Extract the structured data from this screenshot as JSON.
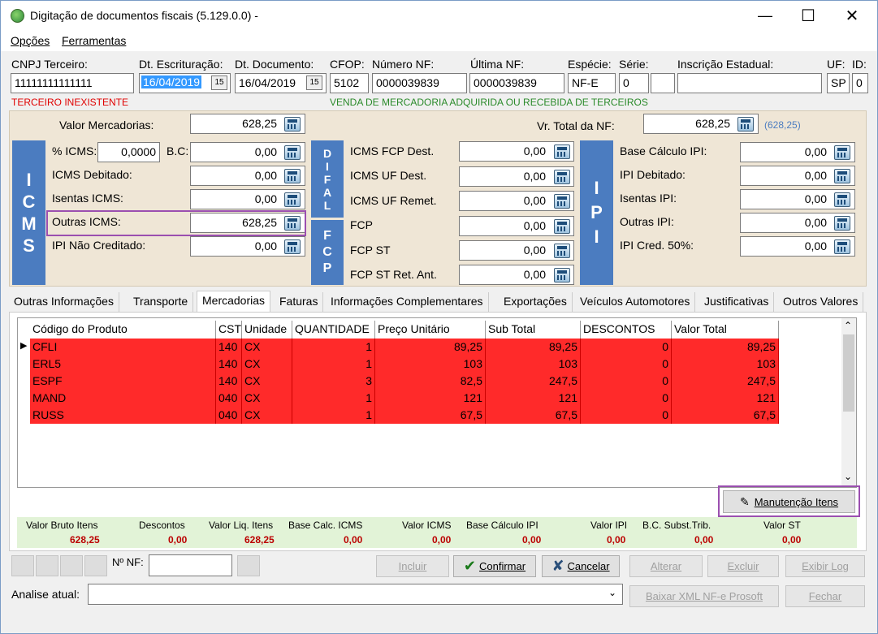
{
  "window": {
    "title": "Digitação de documentos fiscais (5.129.0.0) -"
  },
  "menu": [
    "Opções",
    "Ferramentas"
  ],
  "header": {
    "cnpj_label": "CNPJ Terceiro:",
    "cnpj_value": "11111111111111",
    "cnpj_status": "TERCEIRO INEXISTENTE",
    "dt_escrit_label": "Dt. Escrituração:",
    "dt_escrit_value": "16/04/2019",
    "dt_doc_label": "Dt. Documento:",
    "dt_doc_value": "16/04/2019",
    "cfop_label": "CFOP:",
    "cfop_value": "5102",
    "num_nf_label": "Número NF:",
    "num_nf_value": "0000039839",
    "ult_nf_label": "Última NF:",
    "ult_nf_value": "0000039839",
    "especie_label": "Espécie:",
    "especie_value": "NF-E",
    "serie_label": "Série:",
    "serie_value": "0",
    "ie_label": "Inscrição Estadual:",
    "ie_value": "",
    "uf_label": "UF:",
    "uf_value": "SP",
    "id_label": "ID:",
    "id_value": "0",
    "cfop_desc": "VENDA DE MERCADORIA ADQUIRIDA OU RECEBIDA DE TERCEIROS"
  },
  "values": {
    "valor_merc_label": "Valor Mercadorias:",
    "valor_merc": "628,25",
    "vr_total_label": "Vr. Total da NF:",
    "vr_total": "628,25",
    "vr_total_hint": "(628,25)"
  },
  "icms": {
    "band": "I C M S",
    "pct_label": "% ICMS:",
    "pct": "0,0000",
    "bc_label": "B.C:",
    "bc": "0,00",
    "debitado_label": "ICMS Debitado:",
    "debitado": "0,00",
    "isentas_label": "Isentas ICMS:",
    "isentas": "0,00",
    "outras_label": "Outras ICMS:",
    "outras": "628,25",
    "ipi_nc_label": "IPI Não Creditado:",
    "ipi_nc": "0,00"
  },
  "difal": {
    "band1": "D I F A L",
    "band2": "F C P",
    "fcp_dest_label": "ICMS FCP Dest.",
    "fcp_dest": "0,00",
    "uf_dest_label": "ICMS UF Dest.",
    "uf_dest": "0,00",
    "uf_remet_label": "ICMS UF Remet.",
    "uf_remet": "0,00",
    "fcp_label": "FCP",
    "fcp": "0,00",
    "fcp_st_label": "FCP ST",
    "fcp_st": "0,00",
    "fcp_st_ret_label": "FCP ST Ret. Ant.",
    "fcp_st_ret": "0,00"
  },
  "ipi": {
    "band": "I P I",
    "base_label": "Base Cálculo IPI:",
    "base": "0,00",
    "debitado_label": "IPI Debitado:",
    "debitado": "0,00",
    "isentas_label": "Isentas IPI:",
    "isentas": "0,00",
    "outras_label": "Outras IPI:",
    "outras": "0,00",
    "cred_label": "IPI Cred. 50%:",
    "cred": "0,00"
  },
  "tabs": [
    "Outras Informações",
    "Transporte",
    "Mercadorias",
    "Faturas",
    "Informações Complementares",
    "Exportações",
    "Veículos Automotores",
    "Justificativas",
    "Outros Valores"
  ],
  "grid": {
    "columns": [
      "Código do Produto",
      "CST",
      "Unidade",
      "QUANTIDADE",
      "Preço Unitário",
      "Sub Total",
      "DESCONTOS",
      "Valor Total"
    ],
    "rows": [
      [
        "CFLI",
        "140",
        "CX",
        "1",
        "89,25",
        "89,25",
        "0",
        "89,25"
      ],
      [
        "ERL5",
        "140",
        "CX",
        "1",
        "103",
        "103",
        "0",
        "103"
      ],
      [
        "ESPF",
        "140",
        "CX",
        "3",
        "82,5",
        "247,5",
        "0",
        "247,5"
      ],
      [
        "MAND",
        "040",
        "CX",
        "1",
        "121",
        "121",
        "0",
        "121"
      ],
      [
        "RUSS",
        "040",
        "CX",
        "1",
        "67,5",
        "67,5",
        "0",
        "67,5"
      ]
    ]
  },
  "manut_button": "Manutenção Itens",
  "totals": {
    "labels": [
      "Valor Bruto Itens",
      "Descontos",
      "Valor Liq. Itens",
      "Base Calc. ICMS",
      "Valor ICMS",
      "Base Cálculo IPI",
      "Valor IPI",
      "B.C. Subst.Trib.",
      "Valor ST"
    ],
    "values": [
      "628,25",
      "0,00",
      "628,25",
      "0,00",
      "0,00",
      "0,00",
      "0,00",
      "0,00",
      "0,00"
    ]
  },
  "footer": {
    "nf_label": "Nº NF:",
    "nf_value": "",
    "incluir": "Incluir",
    "confirmar": "Confirmar",
    "cancelar": "Cancelar",
    "alterar": "Alterar",
    "excluir": "Excluir",
    "exibir_log": "Exibir Log",
    "analise_label": "Analise atual:",
    "analise_value": "",
    "baixar": "Baixar XML NF-e Prosoft",
    "fechar": "Fechar"
  }
}
